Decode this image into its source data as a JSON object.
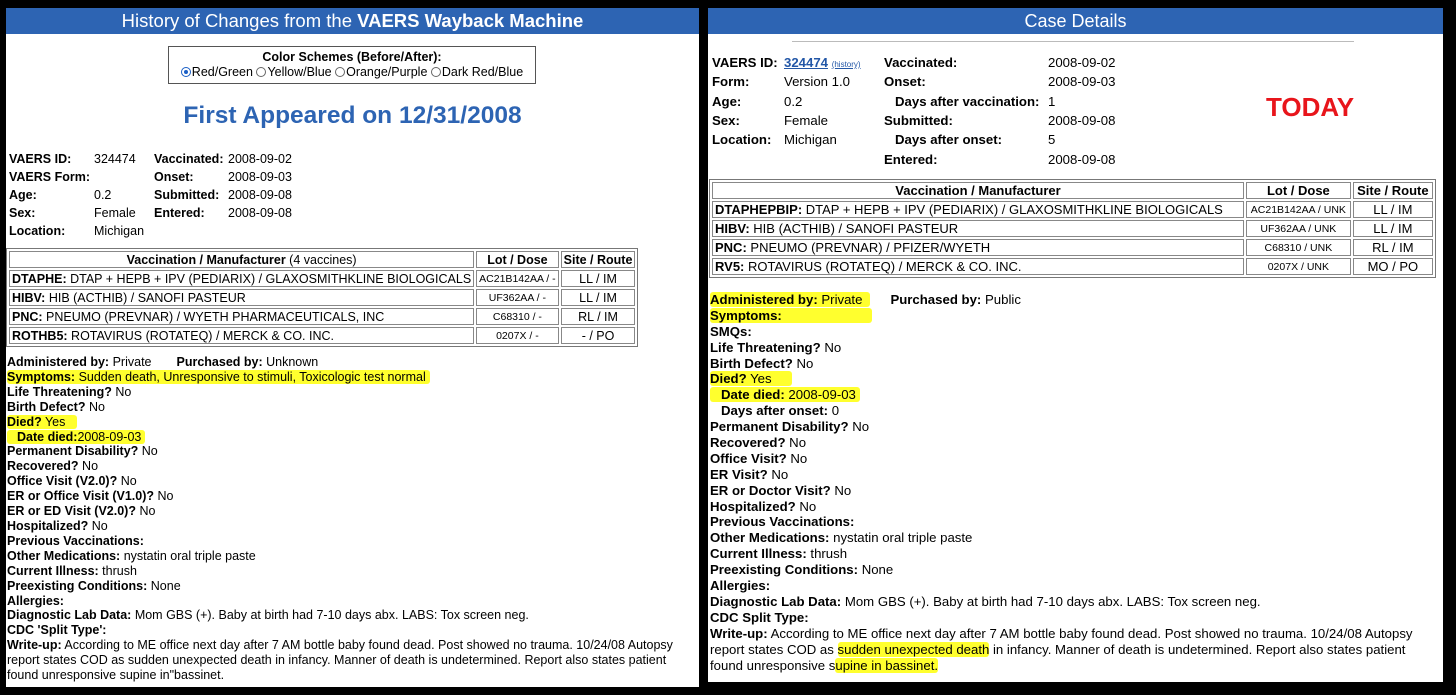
{
  "left": {
    "title_prefix": "History of Changes from the ",
    "title_bold": "VAERS Wayback Machine",
    "schemes_label": "Color Schemes (Before/After):",
    "schemes": [
      "Red/Green",
      "Yellow/Blue",
      "Orange/Purple",
      "Dark Red/Blue"
    ],
    "first_appeared": "First Appeared on 12/31/2008",
    "fields": {
      "vaers_id_label": "VAERS ID:",
      "vaers_id": "324474",
      "form_label": "VAERS Form:",
      "form": "",
      "age_label": "Age:",
      "age": "0.2",
      "sex_label": "Sex:",
      "sex": "Female",
      "location_label": "Location:",
      "location": "Michigan",
      "vaccinated_label": "Vaccinated:",
      "vaccinated": "2008-09-02",
      "onset_label": "Onset:",
      "onset": "2008-09-03",
      "submitted_label": "Submitted:",
      "submitted": "2008-09-08",
      "entered_label": "Entered:",
      "entered": "2008-09-08"
    },
    "table_headers": [
      "Vaccination / Manufacturer",
      "(4 vaccines)",
      "Lot / Dose",
      "Site / Route"
    ],
    "vaccines": [
      {
        "code": "DTAPHE:",
        "desc": " DTAP + HEPB + IPV (PEDIARIX) / GLAXOSMITHKLINE BIOLOGICALS",
        "lot": "AC21B142AA / -",
        "site": "LL / IM"
      },
      {
        "code": "HIBV:",
        "desc": " HIB (ACTHIB) / SANOFI PASTEUR",
        "lot": "UF362AA / -",
        "site": "LL / IM"
      },
      {
        "code": "PNC:",
        "desc": " PNEUMO (PREVNAR) / WYETH PHARMACEUTICALS, INC",
        "lot": "C68310 / -",
        "site": "RL / IM"
      },
      {
        "code": "ROTHB5:",
        "desc": " ROTAVIRUS (ROTATEQ) / MERCK & CO. INC.",
        "lot": "0207X / -",
        "site": "- / PO"
      }
    ],
    "administered_label": "Administered by:",
    "administered": "Private",
    "purchased_label": "Purchased by:",
    "purchased": "Unknown",
    "symptoms_label": "Symptoms:",
    "symptoms": "Sudden death, Unresponsive to stimuli, Toxicologic test normal",
    "details": [
      {
        "label": "Life Threatening?",
        "value": "No"
      },
      {
        "label": "Birth Defect?",
        "value": "No"
      },
      {
        "label": "Died?",
        "value": "Yes"
      },
      {
        "label": "Date died:",
        "value": "2008-09-03"
      },
      {
        "label": "Permanent Disability?",
        "value": "No"
      },
      {
        "label": "Recovered?",
        "value": "No"
      },
      {
        "label": "Office Visit (V2.0)?",
        "value": "No"
      },
      {
        "label": "ER or Office Visit (V1.0)?",
        "value": "No"
      },
      {
        "label": "ER or ED Visit (V2.0)?",
        "value": "No"
      },
      {
        "label": "Hospitalized?",
        "value": "No"
      },
      {
        "label": "Previous Vaccinations:",
        "value": ""
      },
      {
        "label": "Other Medications:",
        "value": "nystatin oral triple paste"
      },
      {
        "label": "Current Illness:",
        "value": "thrush"
      },
      {
        "label": "Preexisting Conditions:",
        "value": "None"
      },
      {
        "label": "Allergies:",
        "value": ""
      },
      {
        "label": "Diagnostic Lab Data:",
        "value": "Mom GBS (+). Baby at birth had 7-10 days abx. LABS: Tox screen neg."
      },
      {
        "label": "CDC 'Split Type':",
        "value": ""
      }
    ],
    "writeup_label": "Write-up:",
    "writeup": "According to ME office next day after 7 AM bottle baby found dead. Post showed no trauma. 10/24/08 Autopsy report states COD as sudden unexpected death in infancy. Manner of death is undetermined. Report also states patient found unresponsive supine in\"bassinet."
  },
  "right": {
    "title": "Case Details",
    "today": "TODAY",
    "fields": {
      "vaers_id_label": "VAERS ID:",
      "vaers_id": "324474",
      "history": "(history)",
      "form_label": "Form:",
      "form": "Version 1.0",
      "age_label": "Age:",
      "age": "0.2",
      "sex_label": "Sex:",
      "sex": "Female",
      "location_label": "Location:",
      "location": "Michigan",
      "vaccinated_label": "Vaccinated:",
      "vaccinated": "2008-09-02",
      "onset_label": "Onset:",
      "onset": "2008-09-03",
      "days_after_vax_label": "Days after vaccination:",
      "days_after_vax": "1",
      "submitted_label": "Submitted:",
      "submitted": "2008-09-08",
      "days_after_onset_label": "Days after onset:",
      "days_after_onset": "5",
      "entered_label": "Entered:",
      "entered": "2008-09-08"
    },
    "table_headers": [
      "Vaccination / Manufacturer",
      "Lot / Dose",
      "Site / Route"
    ],
    "vaccines": [
      {
        "code": "DTAPHEPBIP:",
        "desc": " DTAP + HEPB + IPV (PEDIARIX) / GLAXOSMITHKLINE BIOLOGICALS",
        "lot": "AC21B142AA / UNK",
        "site": "LL / IM"
      },
      {
        "code": "HIBV:",
        "desc": " HIB (ACTHIB) / SANOFI PASTEUR",
        "lot": "UF362AA / UNK",
        "site": "LL / IM"
      },
      {
        "code": "PNC:",
        "desc": " PNEUMO (PREVNAR) / PFIZER/WYETH",
        "lot": "C68310 / UNK",
        "site": "RL / IM"
      },
      {
        "code": "RV5:",
        "desc": " ROTAVIRUS (ROTATEQ) / MERCK & CO. INC.",
        "lot": "0207X / UNK",
        "site": "MO / PO"
      }
    ],
    "administered_label": "Administered by:",
    "administered": "Private",
    "purchased_label": "Purchased by:",
    "purchased": "Public",
    "symptoms_label": "Symptoms:",
    "smqs_label": "SMQs:",
    "details": [
      {
        "label": "Life Threatening?",
        "value": "No"
      },
      {
        "label": "Birth Defect?",
        "value": "No"
      },
      {
        "label": "Died?",
        "value": "Yes"
      },
      {
        "label": "Date died:",
        "value": "2008-09-03"
      },
      {
        "label": "Days after onset:",
        "value": "0"
      },
      {
        "label": "Permanent Disability?",
        "value": "No"
      },
      {
        "label": "Recovered?",
        "value": "No"
      },
      {
        "label": "Office Visit?",
        "value": "No"
      },
      {
        "label": "ER Visit?",
        "value": "No"
      },
      {
        "label": "ER or Doctor Visit?",
        "value": "No"
      },
      {
        "label": "Hospitalized?",
        "value": "No"
      },
      {
        "label": "Previous Vaccinations:",
        "value": ""
      },
      {
        "label": "Other Medications:",
        "value": "nystatin oral triple paste"
      },
      {
        "label": "Current Illness:",
        "value": "thrush"
      },
      {
        "label": "Preexisting Conditions:",
        "value": "None"
      },
      {
        "label": "Allergies:",
        "value": ""
      },
      {
        "label": "Diagnostic Lab Data:",
        "value": "Mom GBS (+). Baby at birth had 7-10 days abx. LABS: Tox screen neg."
      },
      {
        "label": "CDC Split Type:",
        "value": ""
      }
    ],
    "writeup_label": "Write-up:",
    "writeup_a": "According to ME office next day after 7 AM bottle baby found dead. Post showed no trauma. 10/24/08 Autopsy report states COD as ",
    "writeup_hl1": "sudden unexpected death",
    "writeup_b": " in infancy. Manner of death is undetermined. Report also states patient found unresponsive s",
    "writeup_hl2": "upine in bassinet."
  }
}
